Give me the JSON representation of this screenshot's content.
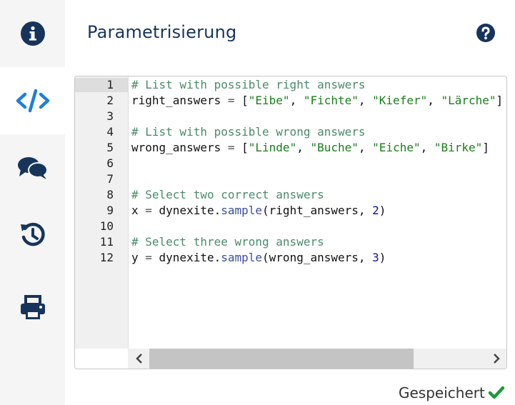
{
  "page": {
    "title": "Parametrisierung",
    "status": "Gespeichert"
  },
  "sidebar": {
    "items": [
      {
        "icon": "info-icon",
        "active": false
      },
      {
        "icon": "code-icon",
        "active": true
      },
      {
        "icon": "comments-icon",
        "active": false
      },
      {
        "icon": "history-icon",
        "active": false
      },
      {
        "icon": "print-icon",
        "active": false
      }
    ]
  },
  "editor": {
    "line_numbers": [
      "1",
      "2",
      "3",
      "4",
      "5",
      "6",
      "7",
      "8",
      "9",
      "10",
      "11",
      "12"
    ]
  },
  "colors": {
    "navy": "#17355a",
    "accent_blue": "#1c7fd8",
    "success_green": "#1e9a3a"
  }
}
